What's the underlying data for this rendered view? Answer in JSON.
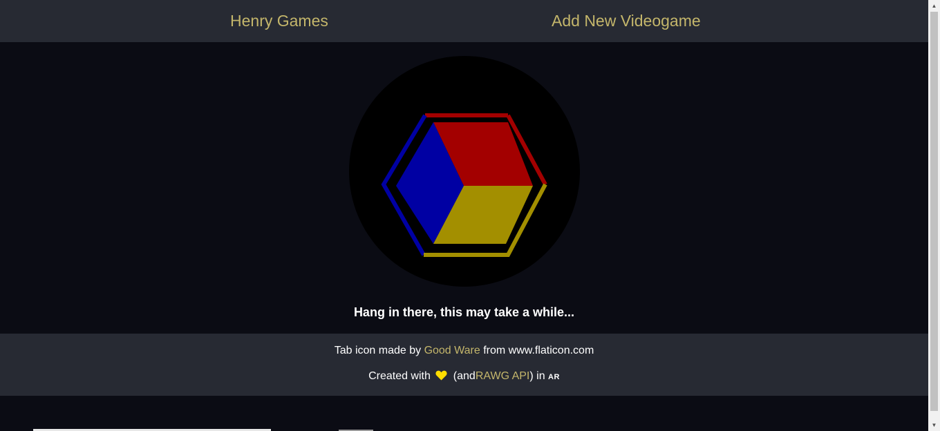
{
  "nav": {
    "home_label": "Henry Games",
    "add_label": "Add New Videogame"
  },
  "loading": {
    "message": "Hang in there, this may take a while..."
  },
  "footer": {
    "credit_prefix": "Tab icon made by",
    "credit_author": "Good Ware",
    "credit_suffix": "from www.flaticon.com",
    "created_prefix": "Created with",
    "heart_icon": "heart-icon",
    "created_middle": "(and",
    "api_link": "RAWG API",
    "created_in": ") in",
    "initials": "AR"
  },
  "colors": {
    "accent": "#c4b66b",
    "nav_bg": "#272a33",
    "page_bg": "#0b0c14",
    "cube_red": "#a30000",
    "cube_blue": "#0000a3",
    "cube_yellow": "#a38f00",
    "heart": "#ffdd00"
  }
}
